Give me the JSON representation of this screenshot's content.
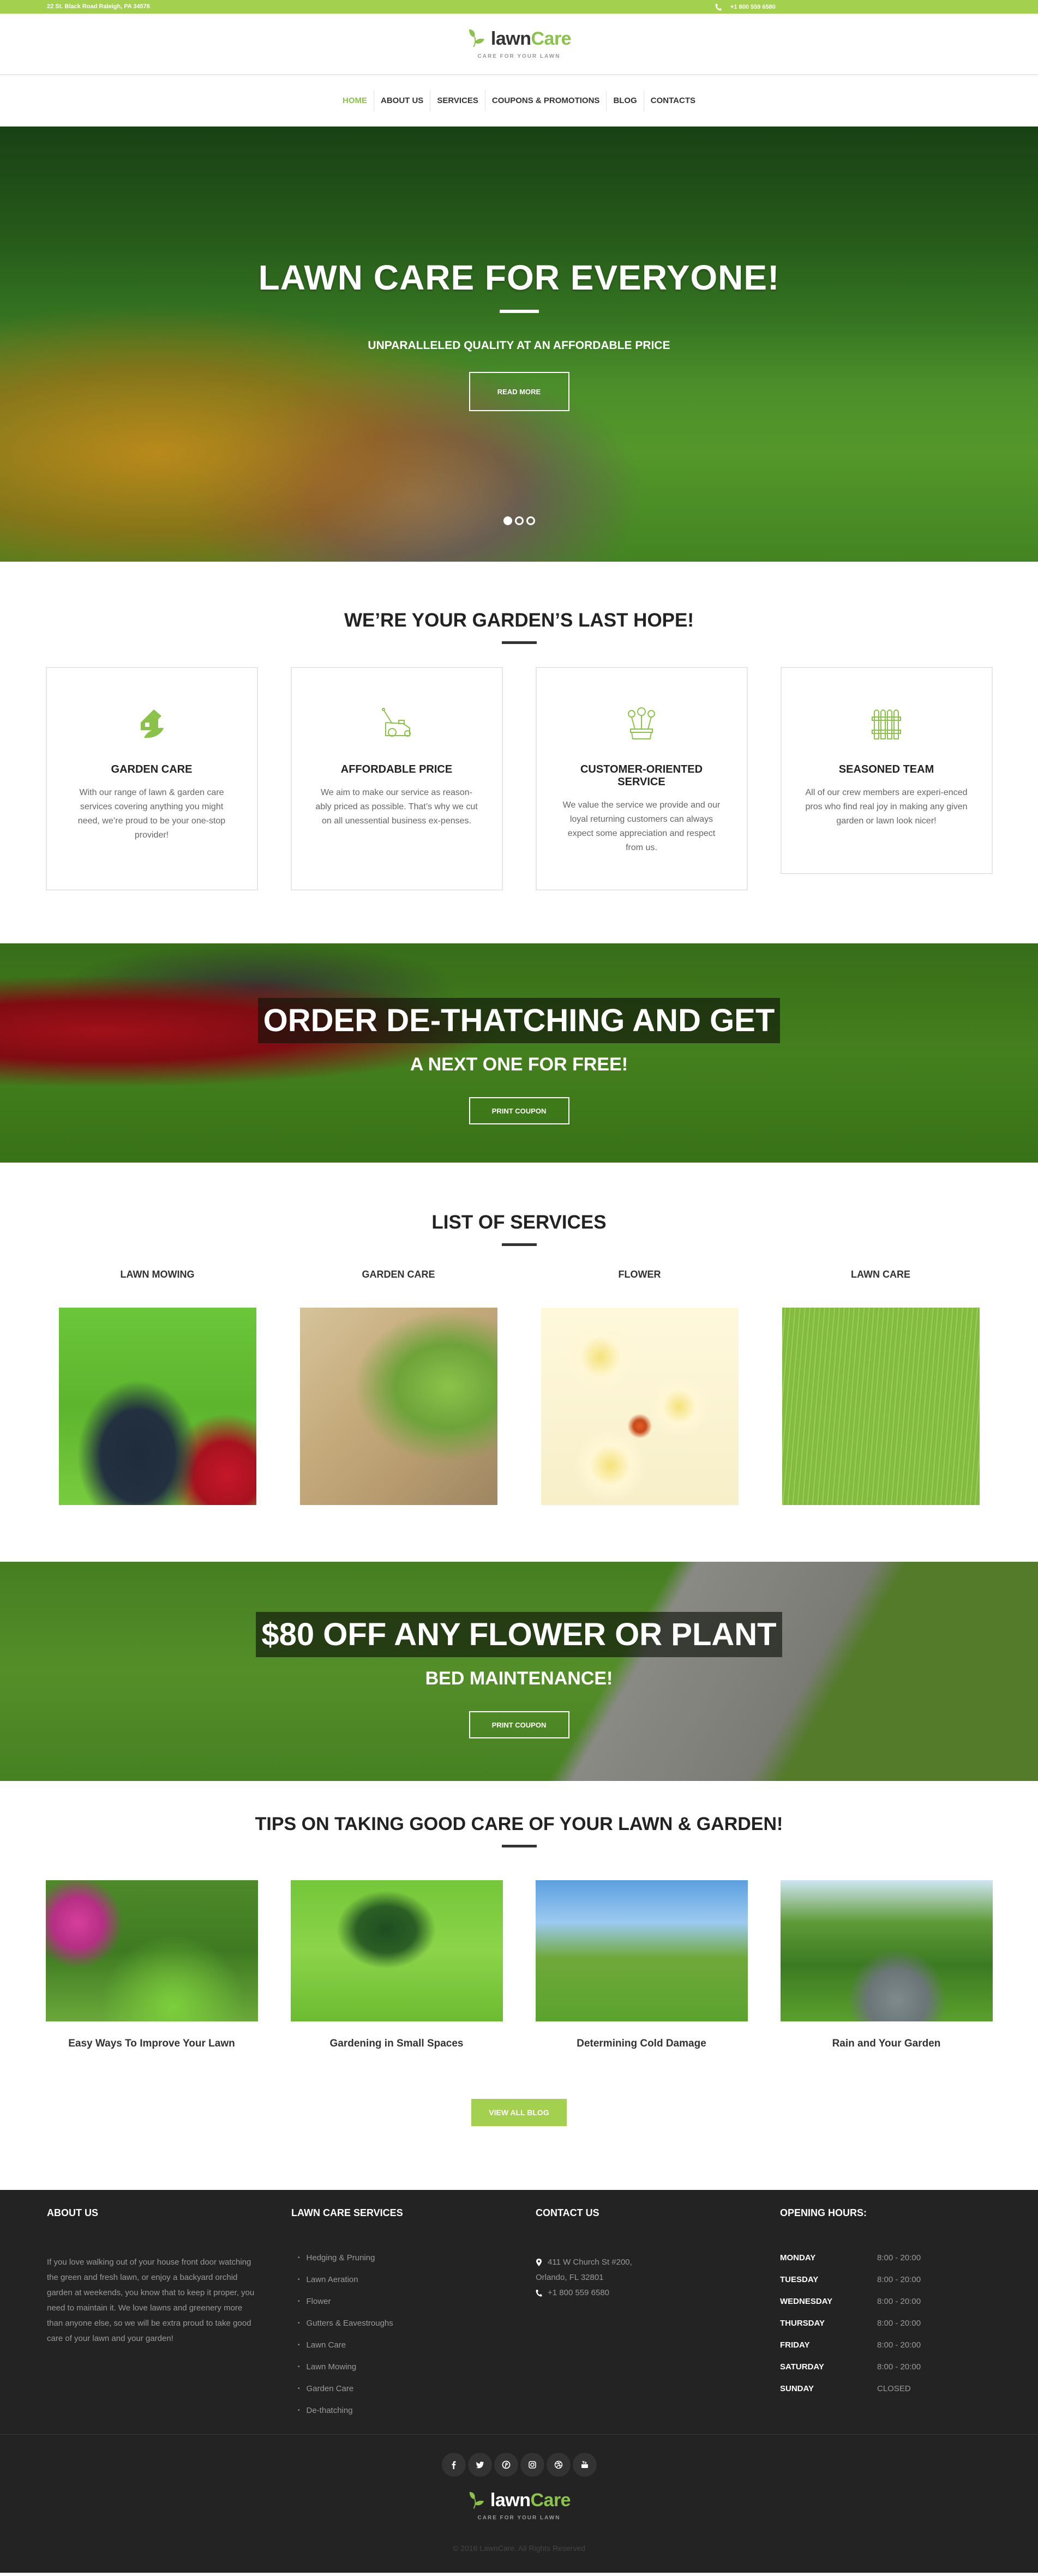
{
  "topbar": {
    "address": "22 St. Black Road Raleigh, PA 34578",
    "phone": "+1 800 559 6580",
    "phone_icon": "phone-icon"
  },
  "brand": {
    "name_part1": "lawn",
    "name_part2": "Care",
    "tagline": "CARE FOR YOUR LAWN",
    "logo_icon": "leaf-icon",
    "accent_color": "#a3d04f"
  },
  "nav": {
    "items": [
      {
        "label": "HOME",
        "active": true
      },
      {
        "label": "ABOUT US"
      },
      {
        "label": "SERVICES"
      },
      {
        "label": "COUPONS & PROMOTIONS"
      },
      {
        "label": "BLOG"
      },
      {
        "label": "CONTACTS"
      }
    ]
  },
  "hero": {
    "title": "LAWN CARE FOR EVERYONE!",
    "subtitle": "UNPARALLELED QUALITY AT AN AFFORDABLE PRICE",
    "button": "READ MORE",
    "slides_total": 3,
    "slide_active": 1
  },
  "features": {
    "title": "WE’RE YOUR GARDEN’S LAST HOPE!",
    "cards": [
      {
        "icon": "house-leaf-icon",
        "title": "GARDEN CARE",
        "text": "With our range of lawn & garden care services covering anything you might need, we’re proud to be your one-stop provider!"
      },
      {
        "icon": "lawn-mower-icon",
        "title": "AFFORDABLE PRICE",
        "text": "We aim to make our service as reason-ably priced as possible. That’s why we cut on all unessential business ex-penses."
      },
      {
        "icon": "flower-pot-icon",
        "title": "CUSTOMER-ORIENTED SERVICE",
        "text": "We value the service we provide and our loyal returning customers can always expect some appreciation and respect from us."
      },
      {
        "icon": "fence-icon",
        "title": "SEASONED TEAM",
        "text": "All of our crew members are experi-enced pros who find real joy in making any given garden or lawn look nicer!"
      }
    ]
  },
  "promo1": {
    "headline": "ORDER DE-THATCHING AND GET",
    "sub": "A NEXT ONE FOR FREE!",
    "button": "PRINT COUPON"
  },
  "services": {
    "title": "LIST OF SERVICES",
    "items": [
      {
        "title": "LAWN MOWING",
        "image": "lawn-mower-photo"
      },
      {
        "title": "GARDEN CARE",
        "image": "stone-garden-bed-photo"
      },
      {
        "title": "FLOWER",
        "image": "white-flowers-butterfly-photo"
      },
      {
        "title": "LAWN CARE",
        "image": "grass-closeup-photo"
      }
    ]
  },
  "promo2": {
    "headline": "$80 OFF ANY FLOWER OR PLANT",
    "sub": "BED MAINTENANCE!",
    "button": "PRINT COUPON"
  },
  "tips": {
    "title": "TIPS ON TAKING GOOD CARE OF YOUR LAWN & GARDEN!",
    "posts": [
      {
        "title": "Easy Ways To Improve Your Lawn",
        "image": "garden-path-photo"
      },
      {
        "title": "Gardening in Small Spaces",
        "image": "hedges-photo"
      },
      {
        "title": "Determining Cold Damage",
        "image": "backyard-house-photo"
      },
      {
        "title": "Rain and Your Garden",
        "image": "japanese-garden-photo"
      }
    ],
    "button": "VIEW ALL BLOG"
  },
  "footer": {
    "about": {
      "title": "ABOUT US",
      "text": "If you love walking out of your house front door watching the green and fresh lawn, or enjoy a backyard orchid garden at weekends, you know that to keep it proper, you need to maintain it. We love lawns and greenery more than anyone else, so we will be extra proud to take good care of your lawn and your garden!"
    },
    "services": {
      "title": "LAWN CARE SERVICES",
      "items": [
        "Hedging & Pruning",
        "Lawn Aeration",
        "Flower",
        "Gutters & Eavestroughs",
        "Lawn Care",
        "Lawn Mowing",
        "Garden Care",
        "De-thatching"
      ]
    },
    "contact": {
      "title": "CONTACT US",
      "address_line1": "411 W Church St #200,",
      "address_line2": "Orlando, FL 32801",
      "phone": "+1 800 559 6580"
    },
    "hours": {
      "title": "OPENING HOURS:",
      "rows": [
        {
          "day": "MONDAY",
          "time": "8:00 - 20:00"
        },
        {
          "day": "TUESDAY",
          "time": "8:00 - 20:00"
        },
        {
          "day": "WEDNESDAY",
          "time": "8:00 - 20:00"
        },
        {
          "day": "THURSDAY",
          "time": "8:00 - 20:00"
        },
        {
          "day": "FRIDAY",
          "time": "8:00 - 20:00"
        },
        {
          "day": "SATURDAY",
          "time": "8:00 - 20:00"
        },
        {
          "day": "SUNDAY",
          "time": "CLOSED"
        }
      ]
    },
    "socials": [
      "facebook-icon",
      "twitter-icon",
      "pinterest-icon",
      "instagram-icon",
      "dribbble-icon",
      "youtube-icon"
    ],
    "copyright": "© 2016 LawnCare. All Rights Reserved"
  }
}
